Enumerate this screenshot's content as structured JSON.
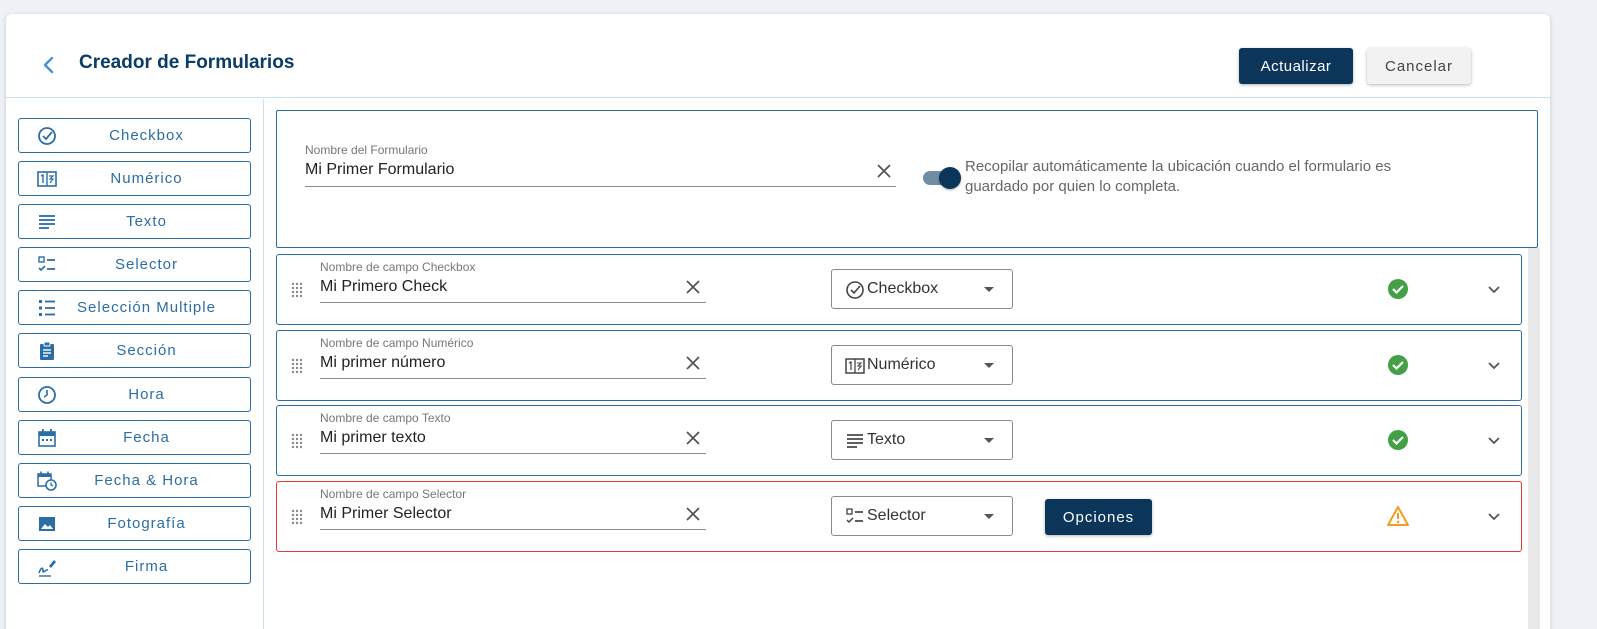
{
  "header": {
    "title": "Creador de Formularios",
    "update_label": "Actualizar",
    "cancel_label": "Cancelar"
  },
  "sidebar": {
    "items": [
      {
        "label": "Checkbox",
        "icon": "check-circle-icon"
      },
      {
        "label": "Numérico",
        "icon": "numeric-icon"
      },
      {
        "label": "Texto",
        "icon": "text-lines-icon"
      },
      {
        "label": "Selector",
        "icon": "checklist-icon"
      },
      {
        "label": "Selección Multiple",
        "icon": "list-icon"
      },
      {
        "label": "Sección",
        "icon": "clipboard-icon"
      },
      {
        "label": "Hora",
        "icon": "clock-icon"
      },
      {
        "label": "Fecha",
        "icon": "calendar-icon"
      },
      {
        "label": "Fecha & Hora",
        "icon": "calendar-clock-icon"
      },
      {
        "label": "Fotografía",
        "icon": "image-icon"
      },
      {
        "label": "Firma",
        "icon": "signature-icon"
      }
    ]
  },
  "form": {
    "name_label": "Nombre del Formulario",
    "name_value": "Mi Primer Formulario",
    "location_toggle_on": true,
    "location_text_line1": "Recopilar automáticamente la ubicación cuando el formulario es",
    "location_text_line2": "guardado por quien lo completa."
  },
  "fields": [
    {
      "label": "Nombre de campo Checkbox",
      "value": "Mi Primero Check",
      "type": "Checkbox",
      "status": "valid"
    },
    {
      "label": "Nombre de campo Numérico",
      "value": "Mi primer número",
      "type": "Numérico",
      "status": "valid"
    },
    {
      "label": "Nombre de campo Texto",
      "value": "Mi primer texto",
      "type": "Texto",
      "status": "valid"
    },
    {
      "label": "Nombre de campo Selector",
      "value": "Mi Primer Selector",
      "type": "Selector",
      "status": "warning",
      "options_label": "Opciones"
    }
  ],
  "colors": {
    "primary": "#0b3559",
    "accent": "#2b6ea6",
    "success": "#43a047",
    "warning": "#f39c1f",
    "error": "#e53935"
  }
}
